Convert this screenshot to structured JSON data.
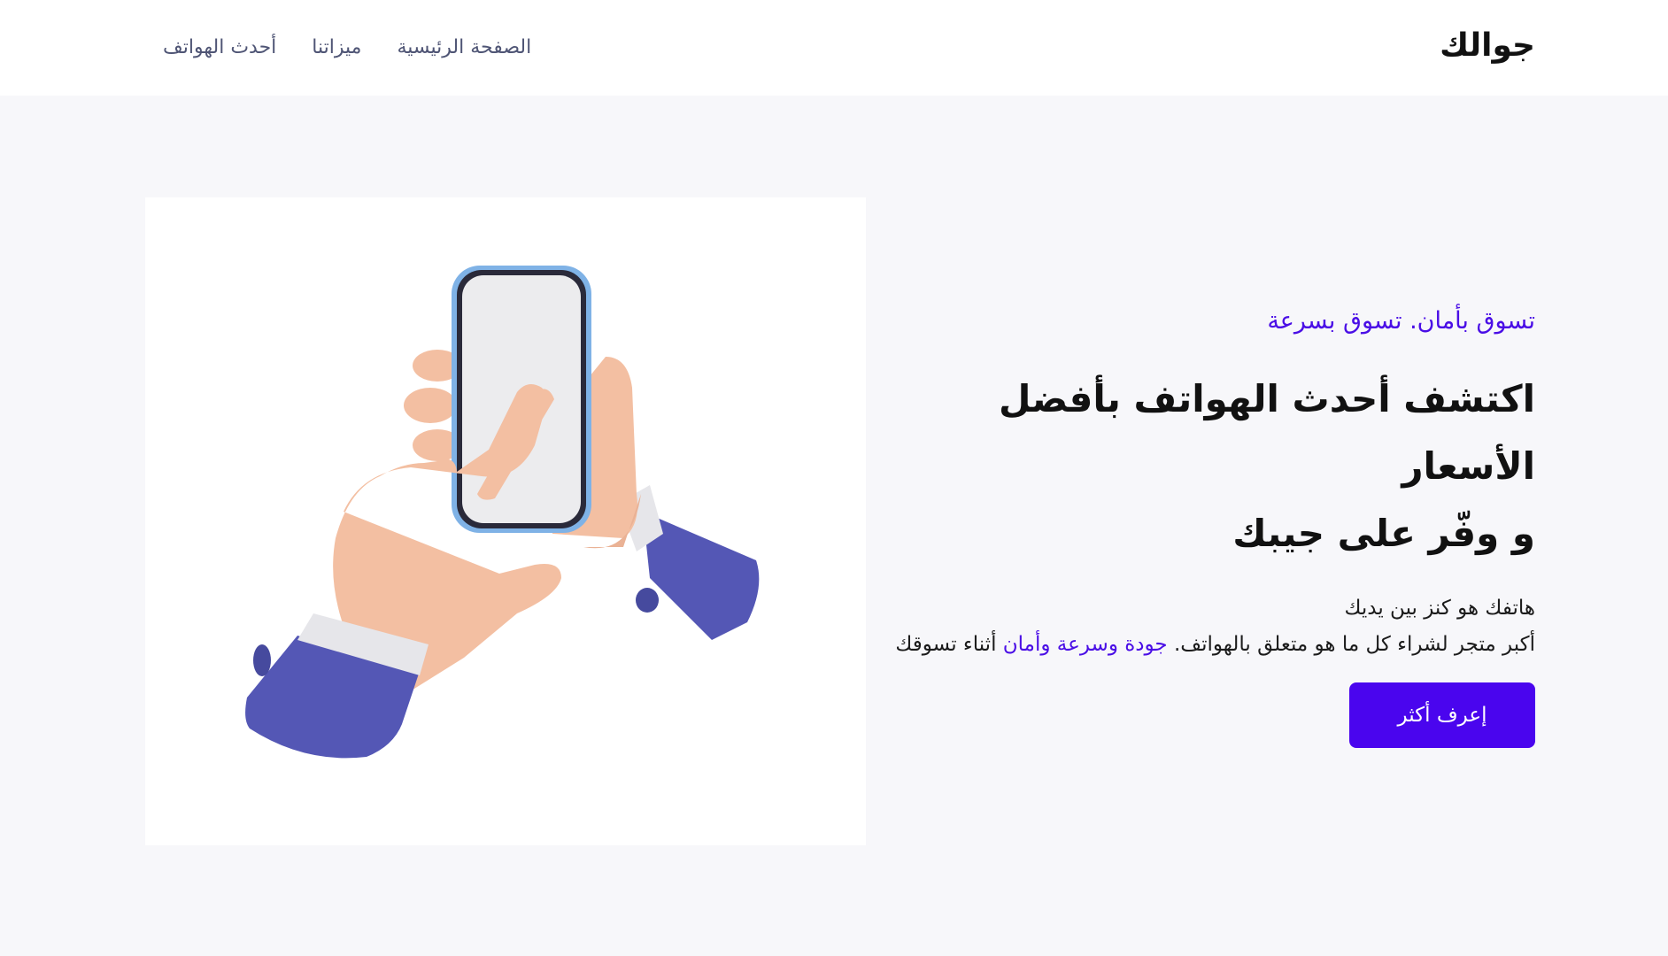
{
  "header": {
    "brand": "جوالك",
    "nav": [
      {
        "label": "الصفحة الرئيسية"
      },
      {
        "label": "ميزاتنا"
      },
      {
        "label": "أحدث الهواتف"
      }
    ]
  },
  "hero": {
    "tagline": "تسوق بأمان. تسوق بسرعة",
    "headline_line1": "اكتشف أحدث الهواتف بأفضل الأسعار",
    "headline_line2": "و وفّر على جيبك",
    "description_line1": "هاتفك هو كنز بين يديك",
    "description_line2_start": "أكبر متجر لشراء كل ما هو متعلق بالهواتف.",
    "description_highlight": "جودة وسرعة وأمان",
    "description_end": "أثناء تسوقك",
    "cta_label": "إعرف أكثر",
    "image": "hands-holding-phone-3d-illustration"
  },
  "colors": {
    "accent": "#4a05ee",
    "background": "#f7f7fa",
    "nav_text": "#4f5575",
    "sleeve": "#5457b5",
    "skin": "#f5c4a8"
  }
}
